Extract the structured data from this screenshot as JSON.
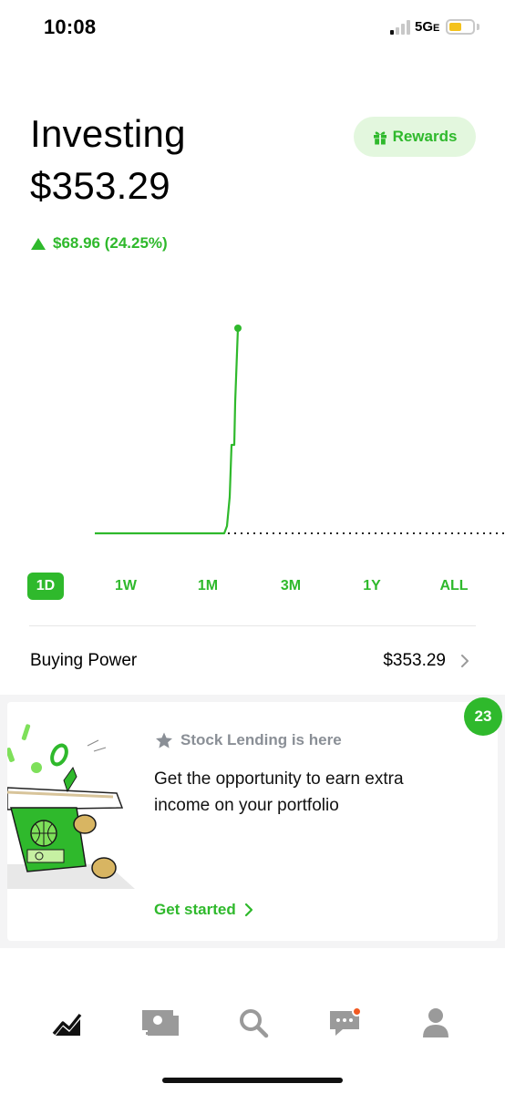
{
  "status_bar": {
    "time": "10:08",
    "network": "5G",
    "network_suffix": "E",
    "battery_level": 0.55
  },
  "header": {
    "title": "Investing",
    "balance": "$353.29",
    "rewards_label": "Rewards",
    "change": "$68.96 (24.25%)",
    "change_direction": "up"
  },
  "theme": {
    "accent": "#2fb92c",
    "accent_light": "#e3f7de",
    "muted": "#8a8f96",
    "notification": "#f15a22"
  },
  "ranges": {
    "items": [
      "1D",
      "1W",
      "1M",
      "3M",
      "1Y",
      "ALL"
    ],
    "active": "1D"
  },
  "buying_power": {
    "label": "Buying Power",
    "value": "$353.29"
  },
  "card": {
    "badge": "23",
    "subtitle": "Stock Lending is here",
    "body": "Get the opportunity to earn extra income on your portfolio",
    "cta": "Get started"
  },
  "nav": {
    "items": [
      "investing-icon",
      "cash-icon",
      "search-icon",
      "messages-icon",
      "account-icon"
    ],
    "active": "investing-icon",
    "has_notification": "messages-icon"
  }
}
